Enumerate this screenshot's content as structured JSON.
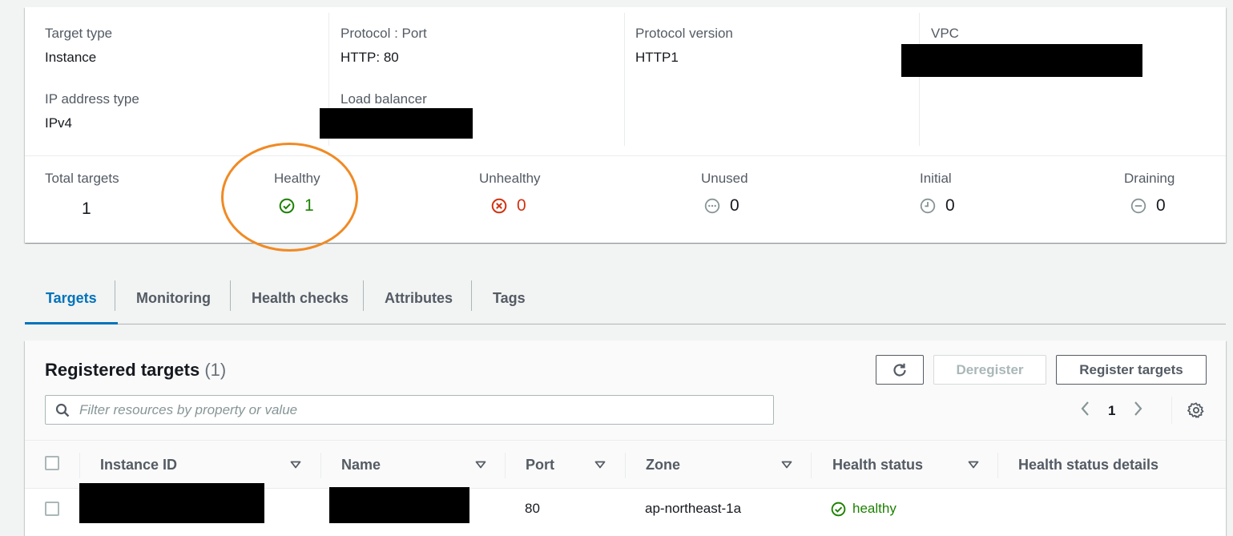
{
  "details": {
    "target_type": {
      "label": "Target type",
      "value": "Instance"
    },
    "ip_address_type": {
      "label": "IP address type",
      "value": "IPv4"
    },
    "protocol_port": {
      "label": "Protocol : Port",
      "value": "HTTP: 80"
    },
    "load_balancer": {
      "label": "Load balancer",
      "value": ""
    },
    "protocol_version": {
      "label": "Protocol version",
      "value": "HTTP1"
    },
    "vpc": {
      "label": "VPC",
      "value": ""
    }
  },
  "stats": {
    "total": {
      "label": "Total targets",
      "value": "1"
    },
    "healthy": {
      "label": "Healthy",
      "value": "1",
      "icon": "check-circle-icon",
      "color": "#1d8102"
    },
    "unhealthy": {
      "label": "Unhealthy",
      "value": "0",
      "icon": "x-circle-icon",
      "color": "#d13212"
    },
    "unused": {
      "label": "Unused",
      "value": "0",
      "icon": "ellipsis-circle-icon"
    },
    "initial": {
      "label": "Initial",
      "value": "0",
      "icon": "clock-icon"
    },
    "draining": {
      "label": "Draining",
      "value": "0",
      "icon": "minus-circle-icon"
    }
  },
  "tabs": [
    {
      "label": "Targets",
      "active": true
    },
    {
      "label": "Monitoring"
    },
    {
      "label": "Health checks"
    },
    {
      "label": "Attributes"
    },
    {
      "label": "Tags"
    }
  ],
  "registered": {
    "title": "Registered targets",
    "count": "(1)",
    "refresh_icon": "refresh-icon",
    "deregister_label": "Deregister",
    "register_label": "Register targets",
    "search_placeholder": "Filter resources by property or value",
    "page": "1",
    "columns": [
      "Instance ID",
      "Name",
      "Port",
      "Zone",
      "Health status",
      "Health status details"
    ],
    "rows": [
      {
        "instance_id": "",
        "name": "",
        "port": "80",
        "zone": "ap-northeast-1a",
        "health_status": "healthy",
        "health_status_details": ""
      }
    ]
  },
  "colors": {
    "accent": "#0073bb",
    "healthy": "#1d8102",
    "unhealthy": "#d13212",
    "annotation": "#f08a24"
  }
}
